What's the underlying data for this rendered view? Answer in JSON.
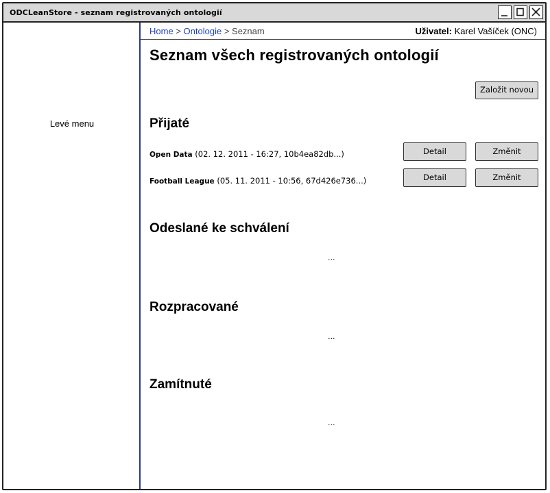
{
  "window": {
    "title": "ODCLeanStore - seznam registrovaných ontologií"
  },
  "left_menu": {
    "label": "Levé menu"
  },
  "breadcrumb": {
    "items": [
      "Home",
      "Ontologie",
      "Seznam"
    ],
    "separator": ">"
  },
  "user": {
    "label": "Uživatel:",
    "name": "Karel Vašíček (ONC)"
  },
  "page": {
    "title": "Seznam všech registrovaných ontologií",
    "create_button": "Založit novou"
  },
  "sections": {
    "accepted": {
      "heading": "Přijaté",
      "items": [
        {
          "name": "Open Data",
          "details": "(02. 12. 2011 - 16:27, 10b4ea82db...)",
          "detail_button": "Detail",
          "change_button": "Změnit"
        },
        {
          "name": "Football League",
          "details": "(05. 11. 2011 - 10:56, 67d426e736...)",
          "detail_button": "Detail",
          "change_button": "Změnit"
        }
      ]
    },
    "submitted": {
      "heading": "Odeslané ke schválení",
      "placeholder": "..."
    },
    "in_progress": {
      "heading": "Rozpracované",
      "placeholder": "..."
    },
    "rejected": {
      "heading": "Zamítnuté",
      "placeholder": "..."
    }
  },
  "colors": {
    "titlebar_bg": "#d9d9d9",
    "button_bg": "#d9d9d9",
    "link": "#1f3fb8",
    "divider": "#2a3a8a"
  },
  "icons": {
    "minimize": "minimize-icon",
    "maximize": "maximize-icon",
    "close": "close-icon"
  }
}
